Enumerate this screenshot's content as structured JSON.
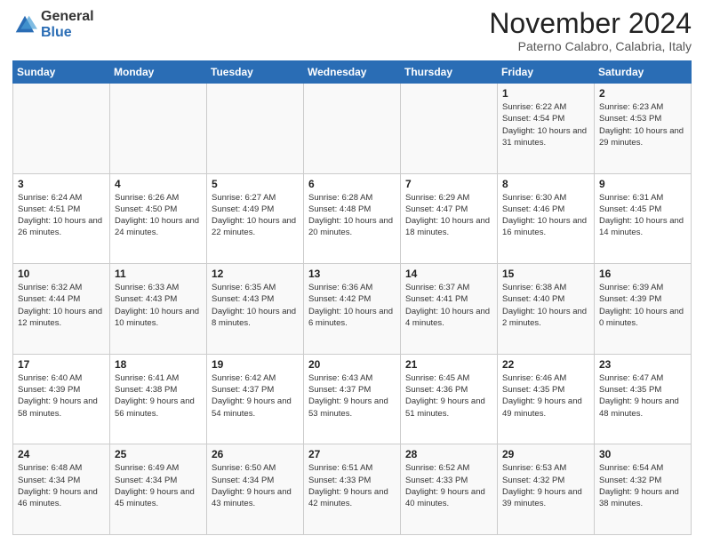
{
  "logo": {
    "general": "General",
    "blue": "Blue"
  },
  "title": "November 2024",
  "location": "Paterno Calabro, Calabria, Italy",
  "days_header": [
    "Sunday",
    "Monday",
    "Tuesday",
    "Wednesday",
    "Thursday",
    "Friday",
    "Saturday"
  ],
  "weeks": [
    [
      {
        "day": "",
        "info": ""
      },
      {
        "day": "",
        "info": ""
      },
      {
        "day": "",
        "info": ""
      },
      {
        "day": "",
        "info": ""
      },
      {
        "day": "",
        "info": ""
      },
      {
        "day": "1",
        "info": "Sunrise: 6:22 AM\nSunset: 4:54 PM\nDaylight: 10 hours and 31 minutes."
      },
      {
        "day": "2",
        "info": "Sunrise: 6:23 AM\nSunset: 4:53 PM\nDaylight: 10 hours and 29 minutes."
      }
    ],
    [
      {
        "day": "3",
        "info": "Sunrise: 6:24 AM\nSunset: 4:51 PM\nDaylight: 10 hours and 26 minutes."
      },
      {
        "day": "4",
        "info": "Sunrise: 6:26 AM\nSunset: 4:50 PM\nDaylight: 10 hours and 24 minutes."
      },
      {
        "day": "5",
        "info": "Sunrise: 6:27 AM\nSunset: 4:49 PM\nDaylight: 10 hours and 22 minutes."
      },
      {
        "day": "6",
        "info": "Sunrise: 6:28 AM\nSunset: 4:48 PM\nDaylight: 10 hours and 20 minutes."
      },
      {
        "day": "7",
        "info": "Sunrise: 6:29 AM\nSunset: 4:47 PM\nDaylight: 10 hours and 18 minutes."
      },
      {
        "day": "8",
        "info": "Sunrise: 6:30 AM\nSunset: 4:46 PM\nDaylight: 10 hours and 16 minutes."
      },
      {
        "day": "9",
        "info": "Sunrise: 6:31 AM\nSunset: 4:45 PM\nDaylight: 10 hours and 14 minutes."
      }
    ],
    [
      {
        "day": "10",
        "info": "Sunrise: 6:32 AM\nSunset: 4:44 PM\nDaylight: 10 hours and 12 minutes."
      },
      {
        "day": "11",
        "info": "Sunrise: 6:33 AM\nSunset: 4:43 PM\nDaylight: 10 hours and 10 minutes."
      },
      {
        "day": "12",
        "info": "Sunrise: 6:35 AM\nSunset: 4:43 PM\nDaylight: 10 hours and 8 minutes."
      },
      {
        "day": "13",
        "info": "Sunrise: 6:36 AM\nSunset: 4:42 PM\nDaylight: 10 hours and 6 minutes."
      },
      {
        "day": "14",
        "info": "Sunrise: 6:37 AM\nSunset: 4:41 PM\nDaylight: 10 hours and 4 minutes."
      },
      {
        "day": "15",
        "info": "Sunrise: 6:38 AM\nSunset: 4:40 PM\nDaylight: 10 hours and 2 minutes."
      },
      {
        "day": "16",
        "info": "Sunrise: 6:39 AM\nSunset: 4:39 PM\nDaylight: 10 hours and 0 minutes."
      }
    ],
    [
      {
        "day": "17",
        "info": "Sunrise: 6:40 AM\nSunset: 4:39 PM\nDaylight: 9 hours and 58 minutes."
      },
      {
        "day": "18",
        "info": "Sunrise: 6:41 AM\nSunset: 4:38 PM\nDaylight: 9 hours and 56 minutes."
      },
      {
        "day": "19",
        "info": "Sunrise: 6:42 AM\nSunset: 4:37 PM\nDaylight: 9 hours and 54 minutes."
      },
      {
        "day": "20",
        "info": "Sunrise: 6:43 AM\nSunset: 4:37 PM\nDaylight: 9 hours and 53 minutes."
      },
      {
        "day": "21",
        "info": "Sunrise: 6:45 AM\nSunset: 4:36 PM\nDaylight: 9 hours and 51 minutes."
      },
      {
        "day": "22",
        "info": "Sunrise: 6:46 AM\nSunset: 4:35 PM\nDaylight: 9 hours and 49 minutes."
      },
      {
        "day": "23",
        "info": "Sunrise: 6:47 AM\nSunset: 4:35 PM\nDaylight: 9 hours and 48 minutes."
      }
    ],
    [
      {
        "day": "24",
        "info": "Sunrise: 6:48 AM\nSunset: 4:34 PM\nDaylight: 9 hours and 46 minutes."
      },
      {
        "day": "25",
        "info": "Sunrise: 6:49 AM\nSunset: 4:34 PM\nDaylight: 9 hours and 45 minutes."
      },
      {
        "day": "26",
        "info": "Sunrise: 6:50 AM\nSunset: 4:34 PM\nDaylight: 9 hours and 43 minutes."
      },
      {
        "day": "27",
        "info": "Sunrise: 6:51 AM\nSunset: 4:33 PM\nDaylight: 9 hours and 42 minutes."
      },
      {
        "day": "28",
        "info": "Sunrise: 6:52 AM\nSunset: 4:33 PM\nDaylight: 9 hours and 40 minutes."
      },
      {
        "day": "29",
        "info": "Sunrise: 6:53 AM\nSunset: 4:32 PM\nDaylight: 9 hours and 39 minutes."
      },
      {
        "day": "30",
        "info": "Sunrise: 6:54 AM\nSunset: 4:32 PM\nDaylight: 9 hours and 38 minutes."
      }
    ]
  ]
}
